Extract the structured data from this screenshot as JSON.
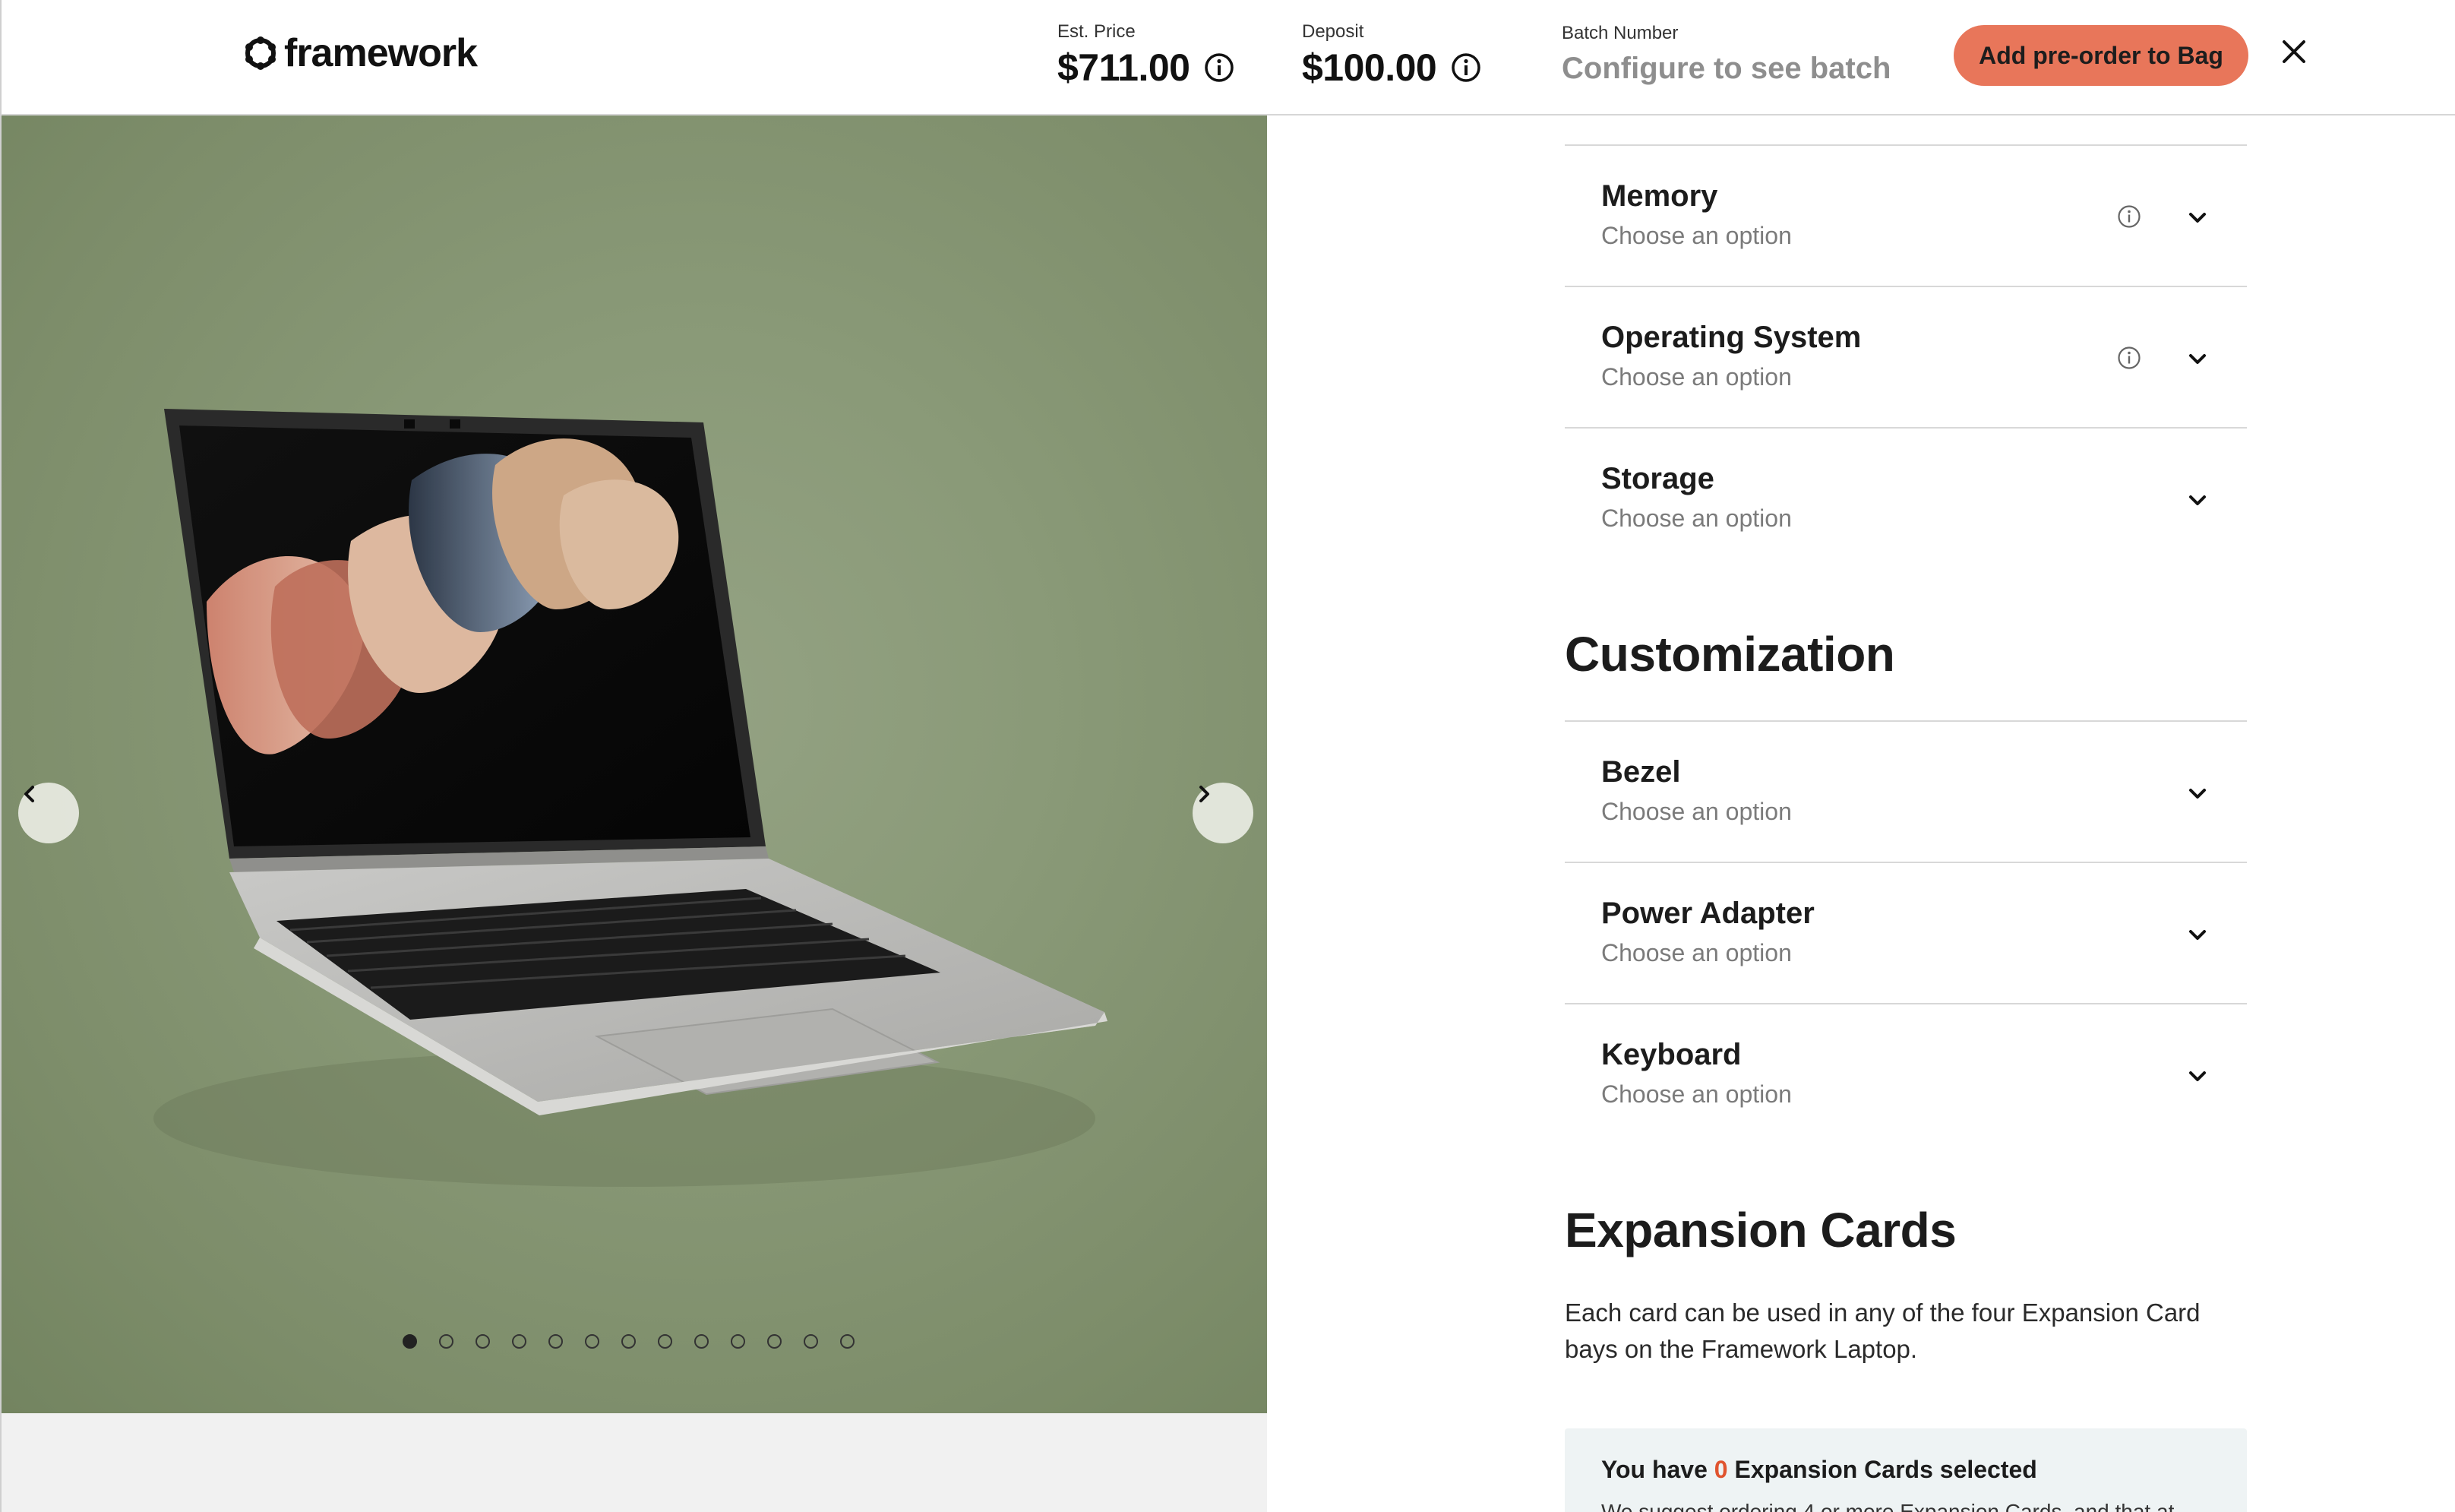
{
  "header": {
    "brand": "framework",
    "est_price_label": "Est. Price",
    "est_price_value": "$711.00",
    "deposit_label": "Deposit",
    "deposit_value": "$100.00",
    "batch_label": "Batch Number",
    "batch_value": "Configure to see batch",
    "cta_label": "Add pre-order to Bag",
    "close_icon": "close-icon"
  },
  "gallery": {
    "slide_count": 13,
    "active_index": 0,
    "prev_icon": "chevron-left-icon",
    "next_icon": "chevron-right-icon"
  },
  "options_group_1": [
    {
      "title": "Memory",
      "subtitle": "Choose an option",
      "has_info": true
    },
    {
      "title": "Operating System",
      "subtitle": "Choose an option",
      "has_info": true
    },
    {
      "title": "Storage",
      "subtitle": "Choose an option",
      "has_info": false
    }
  ],
  "customization": {
    "heading": "Customization",
    "options": [
      {
        "title": "Bezel",
        "subtitle": "Choose an option"
      },
      {
        "title": "Power Adapter",
        "subtitle": "Choose an option"
      },
      {
        "title": "Keyboard",
        "subtitle": "Choose an option"
      }
    ]
  },
  "expansion": {
    "heading": "Expansion Cards",
    "description": "Each card can be used in any of the four Expansion Card bays on the Framework Laptop.",
    "note_prefix": "You have",
    "note_count": "0",
    "note_suffix": "Expansion Cards selected",
    "note_body": "We suggest ordering 4 or more Expansion Cards, and that at"
  },
  "colors": {
    "accent": "#e8765a",
    "count_red": "#e0542f",
    "photo_bg": "#8a9a78",
    "note_bg": "#eef3f4"
  }
}
